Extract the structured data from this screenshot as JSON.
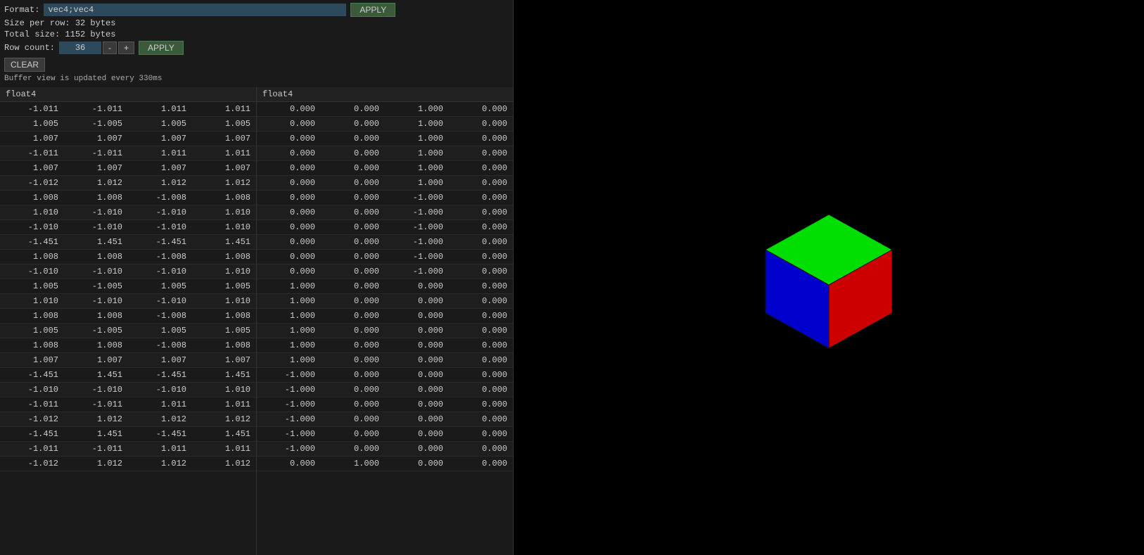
{
  "header": {
    "format_label": "Format:",
    "format_value": "vec4;vec4",
    "apply_label": "APPLY",
    "size_per_row": "Size per row: 32 bytes",
    "total_size": "Total size: 1152 bytes",
    "row_count_label": "Row count:",
    "row_count_value": "36",
    "minus_label": "-",
    "plus_label": "+",
    "clear_label": "CLEAR",
    "update_notice": "Buffer view is updated every 330ms"
  },
  "left_table": {
    "type_header": "float4",
    "rows": [
      [
        "-1.011",
        "-1.011",
        "1.011",
        "1.011"
      ],
      [
        "1.005",
        "-1.005",
        "1.005",
        "1.005"
      ],
      [
        "1.007",
        "1.007",
        "1.007",
        "1.007"
      ],
      [
        "-1.011",
        "-1.011",
        "1.011",
        "1.011"
      ],
      [
        "1.007",
        "1.007",
        "1.007",
        "1.007"
      ],
      [
        "-1.012",
        "1.012",
        "1.012",
        "1.012"
      ],
      [
        "1.008",
        "1.008",
        "-1.008",
        "1.008"
      ],
      [
        "1.010",
        "-1.010",
        "-1.010",
        "1.010"
      ],
      [
        "-1.010",
        "-1.010",
        "-1.010",
        "1.010"
      ],
      [
        "-1.451",
        "1.451",
        "-1.451",
        "1.451"
      ],
      [
        "1.008",
        "1.008",
        "-1.008",
        "1.008"
      ],
      [
        "-1.010",
        "-1.010",
        "-1.010",
        "1.010"
      ],
      [
        "1.005",
        "-1.005",
        "1.005",
        "1.005"
      ],
      [
        "1.010",
        "-1.010",
        "-1.010",
        "1.010"
      ],
      [
        "1.008",
        "1.008",
        "-1.008",
        "1.008"
      ],
      [
        "1.005",
        "-1.005",
        "1.005",
        "1.005"
      ],
      [
        "1.008",
        "1.008",
        "-1.008",
        "1.008"
      ],
      [
        "1.007",
        "1.007",
        "1.007",
        "1.007"
      ],
      [
        "-1.451",
        "1.451",
        "-1.451",
        "1.451"
      ],
      [
        "-1.010",
        "-1.010",
        "-1.010",
        "1.010"
      ],
      [
        "-1.011",
        "-1.011",
        "1.011",
        "1.011"
      ],
      [
        "-1.012",
        "1.012",
        "1.012",
        "1.012"
      ],
      [
        "-1.451",
        "1.451",
        "-1.451",
        "1.451"
      ],
      [
        "-1.011",
        "-1.011",
        "1.011",
        "1.011"
      ],
      [
        "-1.012",
        "1.012",
        "1.012",
        "1.012"
      ]
    ]
  },
  "right_table": {
    "type_header": "float4",
    "rows": [
      [
        "0.000",
        "0.000",
        "1.000",
        "0.000"
      ],
      [
        "0.000",
        "0.000",
        "1.000",
        "0.000"
      ],
      [
        "0.000",
        "0.000",
        "1.000",
        "0.000"
      ],
      [
        "0.000",
        "0.000",
        "1.000",
        "0.000"
      ],
      [
        "0.000",
        "0.000",
        "1.000",
        "0.000"
      ],
      [
        "0.000",
        "0.000",
        "1.000",
        "0.000"
      ],
      [
        "0.000",
        "0.000",
        "-1.000",
        "0.000"
      ],
      [
        "0.000",
        "0.000",
        "-1.000",
        "0.000"
      ],
      [
        "0.000",
        "0.000",
        "-1.000",
        "0.000"
      ],
      [
        "0.000",
        "0.000",
        "-1.000",
        "0.000"
      ],
      [
        "0.000",
        "0.000",
        "-1.000",
        "0.000"
      ],
      [
        "0.000",
        "0.000",
        "-1.000",
        "0.000"
      ],
      [
        "1.000",
        "0.000",
        "0.000",
        "0.000"
      ],
      [
        "1.000",
        "0.000",
        "0.000",
        "0.000"
      ],
      [
        "1.000",
        "0.000",
        "0.000",
        "0.000"
      ],
      [
        "1.000",
        "0.000",
        "0.000",
        "0.000"
      ],
      [
        "1.000",
        "0.000",
        "0.000",
        "0.000"
      ],
      [
        "1.000",
        "0.000",
        "0.000",
        "0.000"
      ],
      [
        "-1.000",
        "0.000",
        "0.000",
        "0.000"
      ],
      [
        "-1.000",
        "0.000",
        "0.000",
        "0.000"
      ],
      [
        "-1.000",
        "0.000",
        "0.000",
        "0.000"
      ],
      [
        "-1.000",
        "0.000",
        "0.000",
        "0.000"
      ],
      [
        "-1.000",
        "0.000",
        "0.000",
        "0.000"
      ],
      [
        "-1.000",
        "0.000",
        "0.000",
        "0.000"
      ],
      [
        "0.000",
        "1.000",
        "0.000",
        "0.000"
      ]
    ]
  },
  "cube": {
    "top_color": "#00dd00",
    "right_color": "#dd0000",
    "left_color": "#0000dd"
  }
}
